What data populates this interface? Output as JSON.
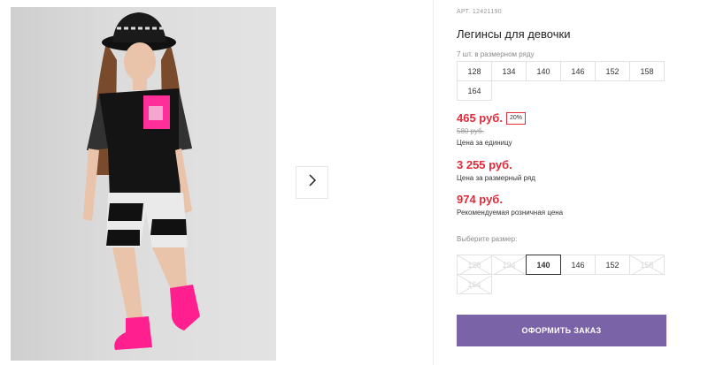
{
  "product": {
    "article": "АРТ. 12421190",
    "title": "Легинсы для девочки",
    "sizes_in_row_label": "7 шт. в размерном ряду",
    "row_sizes": [
      "128",
      "134",
      "140",
      "146",
      "152",
      "158",
      "164"
    ]
  },
  "pricing": {
    "unit_price": "465 руб.",
    "discount_badge": "20%",
    "old_price": "580 руб.",
    "unit_price_label": "Цена за единицу",
    "row_price": "3 255 руб.",
    "row_price_label": "Цена за размерный ряд",
    "retail_price": "974 руб.",
    "retail_price_label": "Рекомендуемая розничная цена"
  },
  "size_selector": {
    "label": "Выберите размер:",
    "options": [
      {
        "value": "128",
        "available": false
      },
      {
        "value": "134",
        "available": false
      },
      {
        "value": "140",
        "available": true,
        "selected": true
      },
      {
        "value": "146",
        "available": true
      },
      {
        "value": "152",
        "available": true
      },
      {
        "value": "158",
        "available": false
      },
      {
        "value": "164",
        "available": false
      }
    ]
  },
  "actions": {
    "order_label": "ОФОРМИТЬ ЗАКАЗ"
  },
  "gallery": {
    "next_icon": "chevron-right-icon"
  },
  "colors": {
    "price_red": "#e22a3a",
    "order_button": "#7a63a6",
    "sneaker_pink": "#ff1f8e"
  }
}
